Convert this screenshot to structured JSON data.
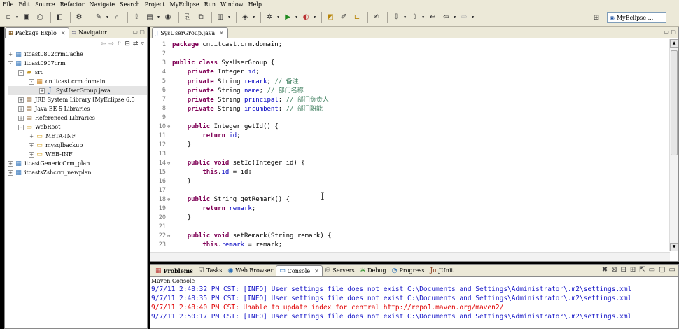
{
  "colors": {
    "keyword": "#7f0055",
    "field": "#0000c0",
    "comment": "#3f7f5f",
    "console_info": "#1a1ac8",
    "console_error": "#e00000",
    "chrome": "#ece9d8"
  },
  "menu": [
    "File",
    "Edit",
    "Source",
    "Refactor",
    "Navigate",
    "Search",
    "Project",
    "MyEclipse",
    "Run",
    "Window",
    "Help"
  ],
  "toolbar": {
    "perspective_label": "MyEclipse ..."
  },
  "left_panel": {
    "tabs": [
      {
        "label": "Package Explo",
        "active": true
      },
      {
        "label": "Navigator",
        "active": false
      }
    ],
    "tree": [
      {
        "label": "itcast0802crmCache",
        "indent": 0,
        "expander": "+",
        "icon": "project-icon"
      },
      {
        "label": "itcast0907crm",
        "indent": 0,
        "expander": "-",
        "icon": "project-icon"
      },
      {
        "label": "src",
        "indent": 1,
        "expander": "-",
        "icon": "source-folder-icon"
      },
      {
        "label": "cn.itcast.crm.domain",
        "indent": 2,
        "expander": "-",
        "icon": "package-icon"
      },
      {
        "label": "SysUserGroup.java",
        "indent": 3,
        "expander": "+",
        "icon": "java-file-icon",
        "selected": true
      },
      {
        "label": "JRE System Library [MyEclipse 6.5",
        "indent": 1,
        "expander": "+",
        "icon": "library-icon"
      },
      {
        "label": "Java EE 5 Libraries",
        "indent": 1,
        "expander": "+",
        "icon": "library-icon"
      },
      {
        "label": "Referenced Libraries",
        "indent": 1,
        "expander": "+",
        "icon": "library-icon"
      },
      {
        "label": "WebRoot",
        "indent": 1,
        "expander": "-",
        "icon": "folder-icon"
      },
      {
        "label": "META-INF",
        "indent": 2,
        "expander": "+",
        "icon": "folder-icon"
      },
      {
        "label": "mysqlbackup",
        "indent": 2,
        "expander": "+",
        "icon": "folder-icon"
      },
      {
        "label": "WEB-INF",
        "indent": 2,
        "expander": "+",
        "icon": "folder-icon"
      },
      {
        "label": "itcastGenericCrm_plan",
        "indent": 0,
        "expander": "+",
        "icon": "project-icon"
      },
      {
        "label": "itcastsZshcrm_newplan",
        "indent": 0,
        "expander": "+",
        "icon": "project-icon"
      }
    ]
  },
  "editor": {
    "tab_label": "SysUserGroup.java",
    "lines": [
      {
        "n": "1",
        "fold": "",
        "t": [
          [
            "kw",
            "package"
          ],
          [
            "p",
            " cn.itcast.crm.domain;"
          ]
        ]
      },
      {
        "n": "2",
        "fold": "",
        "t": []
      },
      {
        "n": "3",
        "fold": "",
        "t": [
          [
            "kw",
            "public class"
          ],
          [
            "p",
            " SysUserGroup {"
          ]
        ]
      },
      {
        "n": "4",
        "fold": "",
        "t": [
          [
            "p",
            "    "
          ],
          [
            "kw",
            "private"
          ],
          [
            "p",
            " Integer "
          ],
          [
            "fd",
            "id"
          ],
          [
            "p",
            ";"
          ]
        ]
      },
      {
        "n": "5",
        "fold": "",
        "t": [
          [
            "p",
            "    "
          ],
          [
            "kw",
            "private"
          ],
          [
            "p",
            " String "
          ],
          [
            "fd",
            "remark"
          ],
          [
            "p",
            "; "
          ],
          [
            "cm",
            "// 备注"
          ]
        ]
      },
      {
        "n": "6",
        "fold": "",
        "t": [
          [
            "p",
            "    "
          ],
          [
            "kw",
            "private"
          ],
          [
            "p",
            " String "
          ],
          [
            "fd",
            "name"
          ],
          [
            "p",
            "; "
          ],
          [
            "cm",
            "// 部门名称"
          ]
        ]
      },
      {
        "n": "7",
        "fold": "",
        "t": [
          [
            "p",
            "    "
          ],
          [
            "kw",
            "private"
          ],
          [
            "p",
            " String "
          ],
          [
            "fd",
            "principal"
          ],
          [
            "p",
            "; "
          ],
          [
            "cm",
            "// 部门负责人"
          ]
        ]
      },
      {
        "n": "8",
        "fold": "",
        "t": [
          [
            "p",
            "    "
          ],
          [
            "kw",
            "private"
          ],
          [
            "p",
            " String "
          ],
          [
            "fd",
            "incumbent"
          ],
          [
            "p",
            "; "
          ],
          [
            "cm",
            "// 部门职能"
          ]
        ]
      },
      {
        "n": "9",
        "fold": "",
        "t": []
      },
      {
        "n": "10",
        "fold": "⊖",
        "t": [
          [
            "p",
            "    "
          ],
          [
            "kw",
            "public"
          ],
          [
            "p",
            " Integer getId() {"
          ]
        ]
      },
      {
        "n": "11",
        "fold": "",
        "t": [
          [
            "p",
            "        "
          ],
          [
            "kw",
            "return"
          ],
          [
            "p",
            " "
          ],
          [
            "fd",
            "id"
          ],
          [
            "p",
            ";"
          ]
        ]
      },
      {
        "n": "12",
        "fold": "",
        "t": [
          [
            "p",
            "    }"
          ]
        ]
      },
      {
        "n": "13",
        "fold": "",
        "t": []
      },
      {
        "n": "14",
        "fold": "⊖",
        "t": [
          [
            "p",
            "    "
          ],
          [
            "kw",
            "public void"
          ],
          [
            "p",
            " setId(Integer id) {"
          ]
        ]
      },
      {
        "n": "15",
        "fold": "",
        "t": [
          [
            "p",
            "        "
          ],
          [
            "kw",
            "this"
          ],
          [
            "p",
            "."
          ],
          [
            "fd",
            "id"
          ],
          [
            "p",
            " = id;"
          ]
        ]
      },
      {
        "n": "16",
        "fold": "",
        "t": [
          [
            "p",
            "    }"
          ]
        ]
      },
      {
        "n": "17",
        "fold": "",
        "t": []
      },
      {
        "n": "18",
        "fold": "⊖",
        "t": [
          [
            "p",
            "    "
          ],
          [
            "kw",
            "public"
          ],
          [
            "p",
            " String getRemark() {"
          ]
        ]
      },
      {
        "n": "19",
        "fold": "",
        "t": [
          [
            "p",
            "        "
          ],
          [
            "kw",
            "return"
          ],
          [
            "p",
            " "
          ],
          [
            "fd",
            "remark"
          ],
          [
            "p",
            ";"
          ]
        ]
      },
      {
        "n": "20",
        "fold": "",
        "t": [
          [
            "p",
            "    }"
          ]
        ]
      },
      {
        "n": "21",
        "fold": "",
        "t": []
      },
      {
        "n": "22",
        "fold": "⊖",
        "t": [
          [
            "p",
            "    "
          ],
          [
            "kw",
            "public void"
          ],
          [
            "p",
            " setRemark(String remark) {"
          ]
        ]
      },
      {
        "n": "23",
        "fold": "",
        "t": [
          [
            "p",
            "        "
          ],
          [
            "kw",
            "this"
          ],
          [
            "p",
            "."
          ],
          [
            "fd",
            "remark"
          ],
          [
            "p",
            " = remark;"
          ]
        ]
      }
    ]
  },
  "bottom_panel": {
    "tabs": [
      {
        "label": "Problems",
        "icon": "problems-icon",
        "active": false
      },
      {
        "label": "Tasks",
        "icon": "tasks-icon",
        "active": false
      },
      {
        "label": "Web Browser",
        "icon": "browser-icon",
        "active": false
      },
      {
        "label": "Console",
        "icon": "console-icon",
        "active": true
      },
      {
        "label": "Servers",
        "icon": "servers-icon",
        "active": false
      },
      {
        "label": "Debug",
        "icon": "debug-icon",
        "active": false
      },
      {
        "label": "Progress",
        "icon": "progress-icon",
        "active": false
      },
      {
        "label": "JUnit",
        "icon": "junit-icon",
        "active": false
      }
    ],
    "console_title": "Maven Console",
    "messages": [
      {
        "text": "9/7/11 2:48:32 PM CST: [INFO] User settings file does not exist C:\\Documents and Settings\\Administrator\\.m2\\settings.xml",
        "level": "info"
      },
      {
        "text": "9/7/11 2:48:35 PM CST: [INFO] User settings file does not exist C:\\Documents and Settings\\Administrator\\.m2\\settings.xml",
        "level": "info"
      },
      {
        "text": "9/7/11 2:48:40 PM CST: Unable to update index for central http://repo1.maven.org/maven2/",
        "level": "error"
      },
      {
        "text": "9/7/11 2:50:17 PM CST: [INFO] User settings file does not exist C:\\Documents and Settings\\Administrator\\.m2\\settings.xml",
        "level": "info"
      }
    ]
  }
}
